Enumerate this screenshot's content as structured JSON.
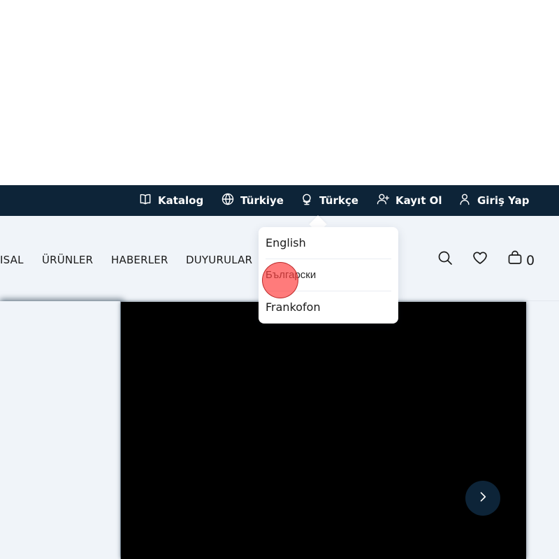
{
  "topbar": {
    "items": [
      {
        "label": "Katalog",
        "icon": "book-icon"
      },
      {
        "label": "Türkiye",
        "icon": "globe-icon"
      },
      {
        "label": "Türkçe",
        "icon": "language-globe-icon"
      },
      {
        "label": "Kayıt Ol",
        "icon": "user-plus-icon"
      },
      {
        "label": "Giriş Yap",
        "icon": "user-icon"
      }
    ]
  },
  "nav": {
    "items": [
      {
        "label": "ISAL"
      },
      {
        "label": "ÜRÜNLER"
      },
      {
        "label": "HABERLER"
      },
      {
        "label": "DUYURULAR"
      }
    ],
    "cart_count": "0"
  },
  "language_dropdown": {
    "options": [
      {
        "label": "English"
      },
      {
        "label": "Български"
      },
      {
        "label": "Frankofon"
      }
    ]
  },
  "colors": {
    "topbar_bg": "#0d2438",
    "header_bg": "#f0f4f9",
    "hero_bg": "#000000",
    "accent": "#0d2438"
  }
}
